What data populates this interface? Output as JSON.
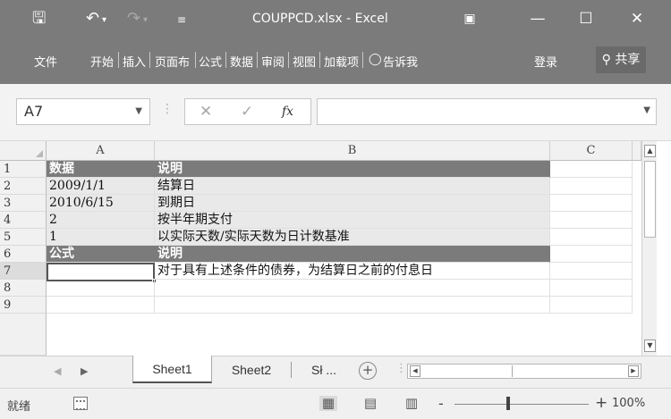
{
  "window": {
    "title": "COUPPCD.xlsx - Excel",
    "icons": [
      "save-icon",
      "undo-icon",
      "redo-icon",
      "customize-qat-icon",
      "ribbon-display-icon",
      "minimize-icon",
      "maximize-icon",
      "close-icon"
    ]
  },
  "ribbon": {
    "tabs": [
      "文件",
      "开始",
      "插入",
      "页面布",
      "公式",
      "数据",
      "审阅",
      "视图",
      "加载项"
    ],
    "tell_me": "告诉我",
    "login": "登录",
    "share": "共享"
  },
  "formula_bar": {
    "name_box": "A7",
    "fx": "fx",
    "formula": ""
  },
  "grid": {
    "columns": [
      "A",
      "B",
      "C"
    ],
    "rows": [
      {
        "num": "1",
        "a": "数据",
        "b": "说明",
        "style": "header"
      },
      {
        "num": "2",
        "a": "2009/1/1",
        "b": "结算日",
        "style": "band"
      },
      {
        "num": "3",
        "a": "2010/6/15",
        "b": "到期日",
        "style": "band"
      },
      {
        "num": "4",
        "a": "2",
        "b": "按半年期支付",
        "style": "band"
      },
      {
        "num": "5",
        "a": "1",
        "b": "以实际天数/实际天数为日计数基准",
        "style": "band"
      },
      {
        "num": "6",
        "a": "公式",
        "b": "说明",
        "style": "header"
      },
      {
        "num": "7",
        "a": "",
        "b": "对于具有上述条件的债券，为结算日之前的付息日",
        "style": "selected"
      },
      {
        "num": "8",
        "a": "",
        "b": "",
        "style": "plain"
      },
      {
        "num": "9",
        "a": "",
        "b": "",
        "style": "plain"
      }
    ]
  },
  "sheets": {
    "tabs": [
      "Sheet1",
      "Sheet2",
      "Sł ..."
    ],
    "active": "Sheet1"
  },
  "status": {
    "ready": "就绪",
    "zoom_minus": "-",
    "zoom_plus": "+",
    "zoom": "100%",
    "zoom_level_value": 100
  }
}
